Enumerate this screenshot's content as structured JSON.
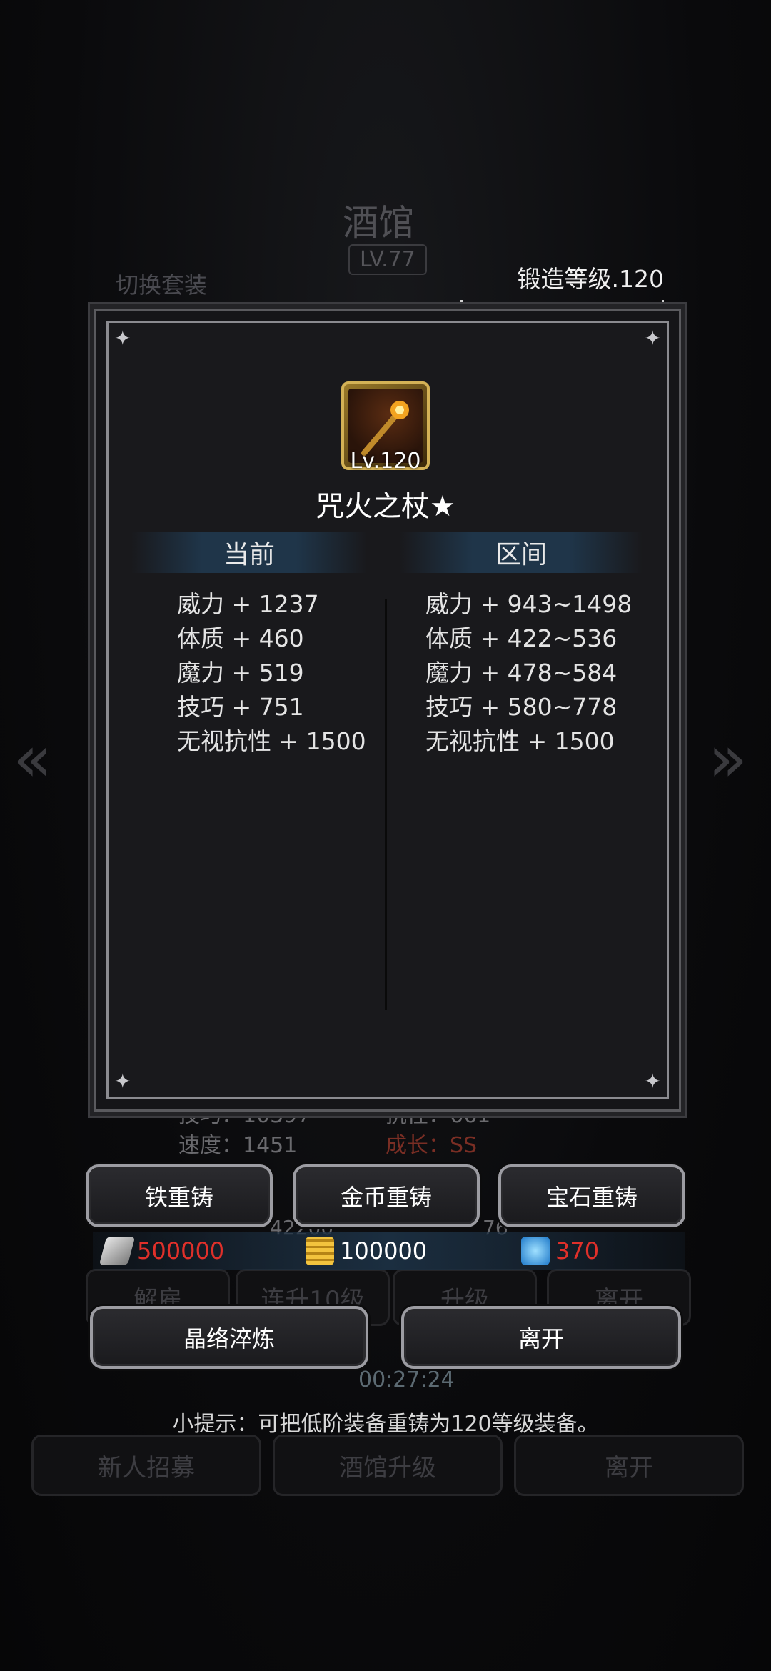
{
  "background": {
    "title": "酒馆",
    "level": "LV.77",
    "switch_label": "切换套装",
    "stats": {
      "skill": "技巧：10397",
      "speed": "速度：1451",
      "resist": "抗性：661",
      "growth": "成长：SS"
    },
    "values": {
      "hp": "42200",
      "other": "76"
    },
    "buttons": [
      "解雇",
      "连升10级",
      "升级",
      "离开"
    ],
    "timer": "00:27:24",
    "bottom_buttons": [
      "新人招募",
      "酒馆升级",
      "离开"
    ]
  },
  "forge_level": "锻造等级.120",
  "item": {
    "level": "Lv.120",
    "name": "咒火之杖★",
    "icon": "fire-staff-icon"
  },
  "columns": {
    "current": "当前",
    "range": "区间"
  },
  "current_stats": [
    "威力 + 1237",
    "体质 + 460",
    "魔力 + 519",
    "技巧 + 751",
    "无视抗性 + 1500"
  ],
  "range_stats": [
    "威力 + 943~1498",
    "体质 + 422~536",
    "魔力 + 478~584",
    "技巧 + 580~778",
    "无视抗性 + 1500"
  ],
  "actions": {
    "iron_reforge": "铁重铸",
    "gold_reforge": "金币重铸",
    "gem_reforge": "宝石重铸",
    "crystal_refine": "晶络淬炼",
    "leave": "离开"
  },
  "resources": {
    "iron": {
      "value": "500000",
      "color": "#e0302a",
      "icon": "iron-ingot-icon"
    },
    "gold": {
      "value": "100000",
      "color": "#ffffff",
      "icon": "gold-coins-icon"
    },
    "gem": {
      "value": "370",
      "color": "#e0302a",
      "icon": "blue-gem-icon"
    }
  },
  "tip": "小提示：可把低阶装备重铸为120等级装备。"
}
